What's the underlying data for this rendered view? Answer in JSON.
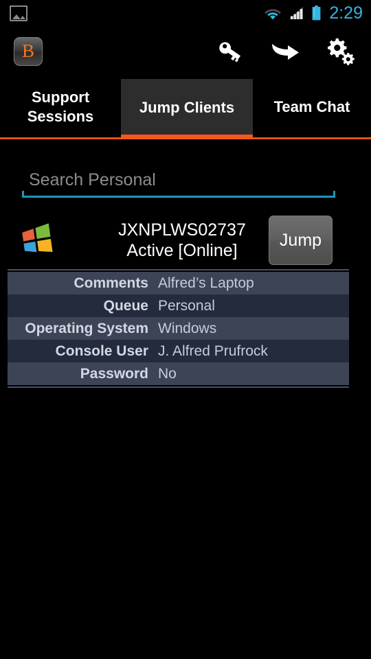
{
  "status_bar": {
    "notification_icon": "image-icon",
    "wifi_icon": "wifi-icon",
    "signal_icon": "cellular-signal-icon",
    "battery_icon": "battery-icon",
    "time": "2:29",
    "accent_color": "#33b5e5"
  },
  "action_bar": {
    "app_logo_letter": "B",
    "app_logo_color": "#ef7622",
    "icons": [
      {
        "name": "key-icon",
        "label": "Credentials"
      },
      {
        "name": "arrow-right-icon",
        "label": "Jump"
      },
      {
        "name": "settings-gears-icon",
        "label": "Settings"
      }
    ]
  },
  "tabs": {
    "items": [
      {
        "label": "Support Sessions",
        "active": false
      },
      {
        "label": "Jump Clients",
        "active": true
      },
      {
        "label": "Team Chat",
        "active": false
      }
    ],
    "active_index": 1,
    "indicator_color": "#f4571a"
  },
  "search": {
    "placeholder": "Search Personal",
    "value": "",
    "underline_color": "#2196b8"
  },
  "jump_client": {
    "os_icon": "windows-logo-icon",
    "hostname": "JXNPLWS02737",
    "status": "Active [Online]",
    "jump_button_label": "Jump"
  },
  "details": {
    "rows": [
      {
        "label": "Comments",
        "value": "Alfred’s Laptop"
      },
      {
        "label": "Queue",
        "value": "Personal"
      },
      {
        "label": "Operating System",
        "value": "Windows"
      },
      {
        "label": "Console User",
        "value": "J. Alfred Prufrock"
      },
      {
        "label": "Password",
        "value": "No"
      }
    ]
  }
}
